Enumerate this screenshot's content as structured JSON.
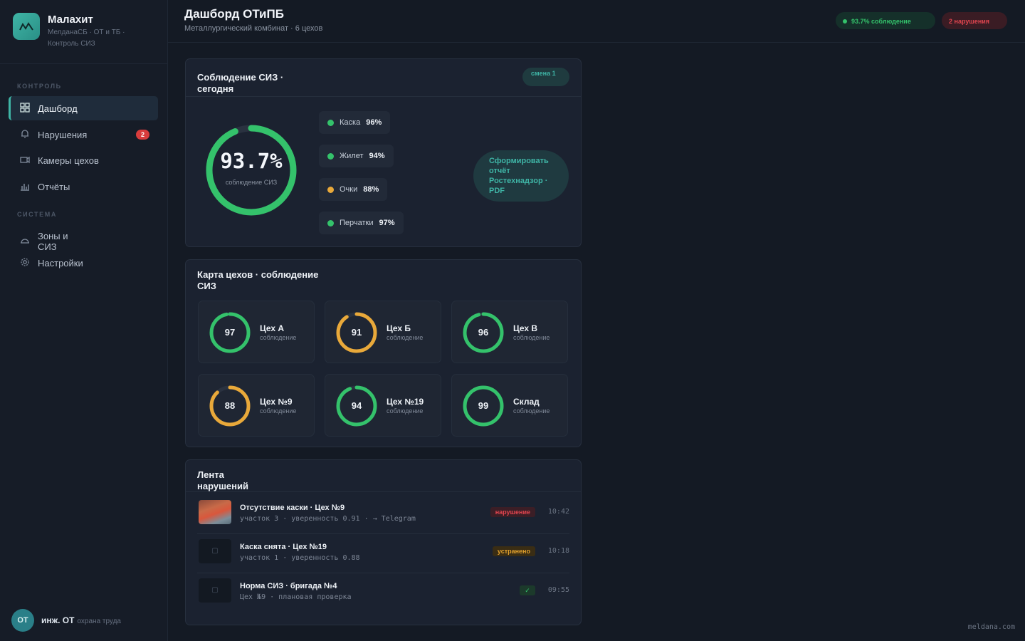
{
  "brand": {
    "name": "Малахит",
    "subtitle": "МелданаСБ · ОТ и ТБ · Контроль СИЗ"
  },
  "sidebar": {
    "section_control": "КОНТРОЛЬ",
    "section_system": "СИСТЕМА",
    "items": [
      {
        "label": "Дашборд",
        "icon": "grid-icon",
        "active": true
      },
      {
        "label": "Нарушения",
        "icon": "bell-icon",
        "badge": "2"
      },
      {
        "label": "Камеры цехов",
        "icon": "camera-icon"
      },
      {
        "label": "Отчёты",
        "icon": "bar-chart-icon"
      },
      {
        "label": "Зоны и СИЗ",
        "icon": "helmet-icon"
      },
      {
        "label": "Настройки",
        "icon": "gear-icon"
      }
    ],
    "user": {
      "initials": "ОТ",
      "name": "инж. ОТ",
      "role": "охрана труда"
    }
  },
  "header": {
    "title": "Дашборд ОТиПБ",
    "subtitle": "Металлургический комбинат · 6 цехов",
    "compliance_pill": "93.7% соблюдение",
    "violations_pill": "2 нарушения"
  },
  "compliance_card": {
    "title": "Соблюдение СИЗ · сегодня",
    "shift": "смена 1",
    "overall_value": "93.7%",
    "overall_fraction": 0.937,
    "overall_label": "соблюдение СИЗ",
    "ppe": [
      {
        "name": "Каска",
        "value": "96%",
        "status": "ok"
      },
      {
        "name": "Жилет",
        "value": "94%",
        "status": "ok"
      },
      {
        "name": "Очки",
        "value": "88%",
        "status": "warn"
      },
      {
        "name": "Перчатки",
        "value": "97%",
        "status": "ok"
      }
    ],
    "report_button": "Сформировать отчёт Ростехнадзор · PDF"
  },
  "shops_card": {
    "title": "Карта цехов · соблюдение СИЗ",
    "sub_label": "соблюдение",
    "shops": [
      {
        "name": "Цех А",
        "value": 97,
        "status": "ok"
      },
      {
        "name": "Цех Б",
        "value": 91,
        "status": "warn"
      },
      {
        "name": "Цех В",
        "value": 96,
        "status": "ok"
      },
      {
        "name": "Цех №9",
        "value": 88,
        "status": "warn"
      },
      {
        "name": "Цех №19",
        "value": 94,
        "status": "ok"
      },
      {
        "name": "Склад",
        "value": 99,
        "status": "ok"
      }
    ]
  },
  "feed_card": {
    "title": "Лента нарушений",
    "events": [
      {
        "title": "Отсутствие каски · Цех №9",
        "meta": "участок 3 · уверенность 0.91 · → Telegram",
        "tag": "нарушение",
        "tag_type": "bad",
        "time": "10:42",
        "has_photo": true
      },
      {
        "title": "Каска снята · Цех №19",
        "meta": "участок 1 · уверенность 0.88",
        "tag": "устранено",
        "tag_type": "fixed",
        "time": "10:18",
        "has_photo": false
      },
      {
        "title": "Норма СИЗ · бригада №4",
        "meta": "Цех №9 · плановая проверка",
        "tag": "✓",
        "tag_type": "ok",
        "time": "09:55",
        "has_photo": false
      }
    ]
  },
  "footer": {
    "url": "meldana.com"
  },
  "colors": {
    "ok": "#34c26b",
    "warn": "#e9a93a",
    "bad": "#e0454f",
    "accent": "#3fb5a6",
    "track": "#2a3240"
  }
}
